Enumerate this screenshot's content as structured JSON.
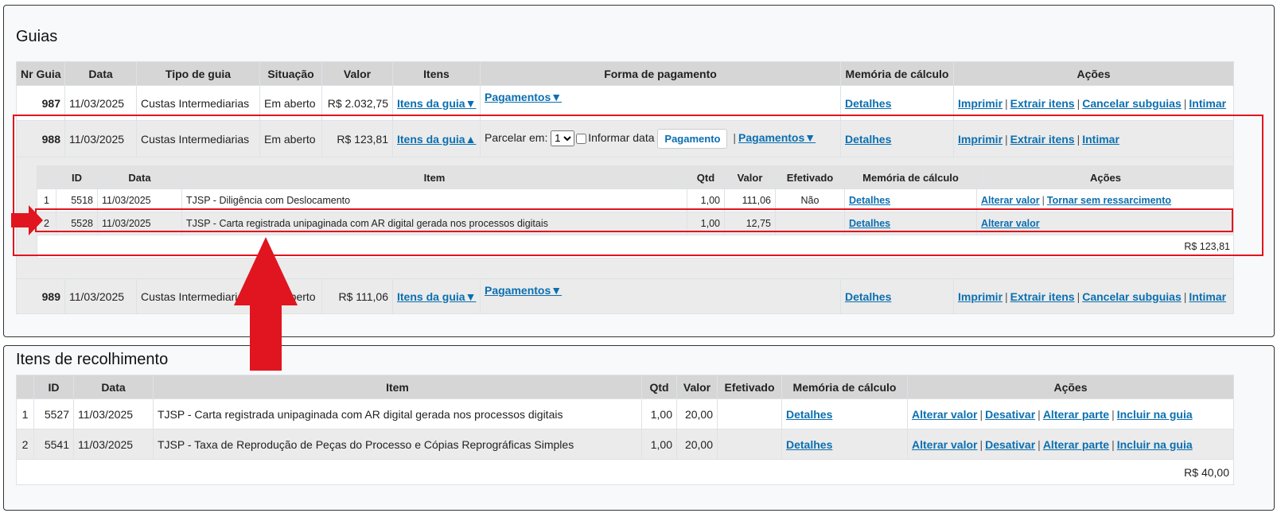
{
  "guias": {
    "title": "Guias",
    "headers": [
      "Nr Guia",
      "Data",
      "Tipo de guia",
      "Situação",
      "Valor",
      "Itens",
      "Forma de pagamento",
      "Memória de cálculo",
      "Ações"
    ],
    "rows": [
      {
        "nr": "987",
        "data": "11/03/2025",
        "tipo": "Custas Intermediarias",
        "situacao": "Em aberto",
        "valor": "R$ 2.032,75",
        "itens": "Itens da guia▼",
        "pagamentos": "Pagamentos▼",
        "memoria": "Detalhes",
        "acoes": [
          "Imprimir",
          "Extrair itens",
          "Cancelar subguias",
          "Intimar"
        ]
      },
      {
        "nr": "988",
        "data": "11/03/2025",
        "tipo": "Custas Intermediarias",
        "situacao": "Em aberto",
        "valor": "R$ 123,81",
        "itens": "Itens da guia▲",
        "parcelar_label": "Parcelar em:",
        "parcelar_value": "1",
        "informar_data": "Informar data",
        "pagamento_button": "Pagamento",
        "pagamentos": "Pagamentos▼",
        "memoria": "Detalhes",
        "acoes": [
          "Imprimir",
          "Extrair itens",
          "Intimar"
        ]
      },
      {
        "nr": "989",
        "data": "11/03/2025",
        "tipo": "Custas Intermediarias",
        "situacao": "Em aberto",
        "valor": "R$ 111,06",
        "itens": "Itens da guia▼",
        "pagamentos": "Pagamentos▼",
        "memoria": "Detalhes",
        "acoes": [
          "Imprimir",
          "Extrair itens",
          "Cancelar subguias",
          "Intimar"
        ]
      }
    ],
    "subtable": {
      "headers": [
        "",
        "ID",
        "Data",
        "Item",
        "Qtd",
        "Valor",
        "Efetivado",
        "Memória de cálculo",
        "Ações"
      ],
      "rows": [
        {
          "n": "1",
          "id": "5518",
          "data": "11/03/2025",
          "item": "TJSP - Diligência com Deslocamento",
          "qtd": "1,00",
          "valor": "111,06",
          "efetivado": "Não",
          "memoria": "Detalhes",
          "acoes": [
            "Alterar valor",
            "Tornar sem ressarcimento"
          ]
        },
        {
          "n": "2",
          "id": "5528",
          "data": "11/03/2025",
          "item": "TJSP - Carta registrada unipaginada com AR digital gerada nos processos digitais",
          "qtd": "1,00",
          "valor": "12,75",
          "efetivado": "",
          "memoria": "Detalhes",
          "acoes": [
            "Alterar valor"
          ]
        }
      ],
      "total": "R$ 123,81"
    }
  },
  "itens_recolhimento": {
    "title": "Itens de recolhimento",
    "headers": [
      "",
      "ID",
      "Data",
      "Item",
      "Qtd",
      "Valor",
      "Efetivado",
      "Memória de cálculo",
      "Ações"
    ],
    "rows": [
      {
        "n": "1",
        "id": "5527",
        "data": "11/03/2025",
        "item": "TJSP - Carta registrada unipaginada com AR digital gerada nos processos digitais",
        "qtd": "1,00",
        "valor": "20,00",
        "efetivado": "",
        "memoria": "Detalhes",
        "acoes": [
          "Alterar valor",
          "Desativar",
          "Alterar parte",
          "Incluir na guia"
        ]
      },
      {
        "n": "2",
        "id": "5541",
        "data": "11/03/2025",
        "item": "TJSP - Taxa de Reprodução de Peças do Processo e Cópias Reprográficas Simples",
        "qtd": "1,00",
        "valor": "20,00",
        "efetivado": "",
        "memoria": "Detalhes",
        "acoes": [
          "Alterar valor",
          "Desativar",
          "Alterar parte",
          "Incluir na guia"
        ]
      }
    ],
    "total": "R$ 40,00"
  },
  "annotation_colors": {
    "highlight": "#e0151f"
  }
}
